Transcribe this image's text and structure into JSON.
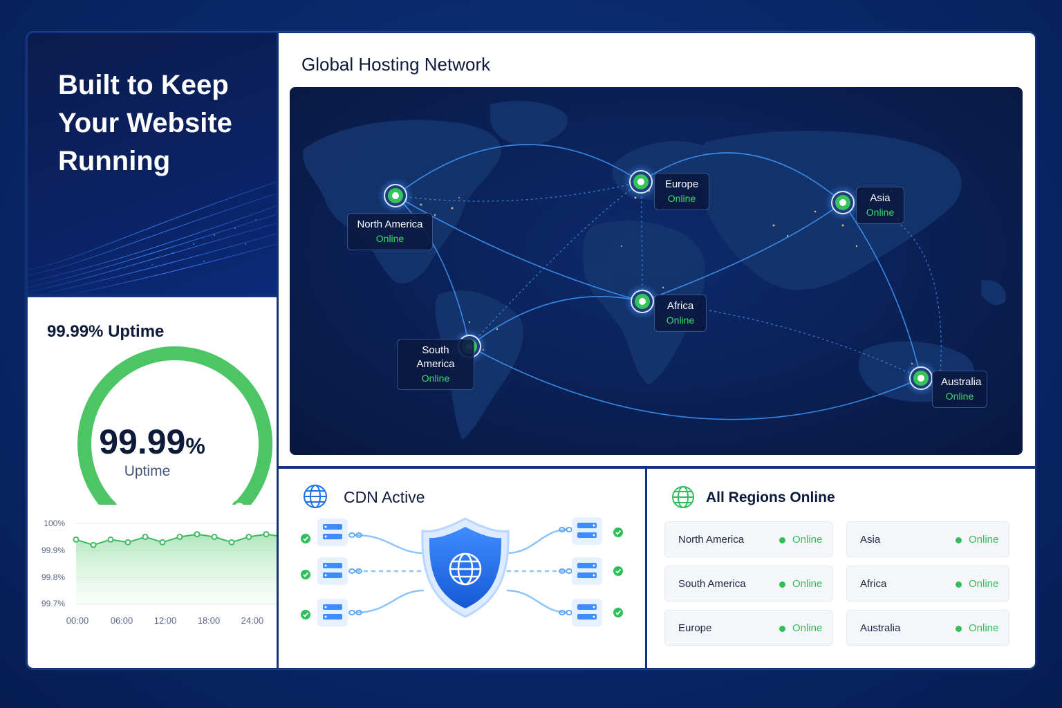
{
  "hero": {
    "headline_lines": [
      "Built to Keep",
      "Your Website",
      "Running"
    ]
  },
  "uptime": {
    "title": "99.99% Uptime",
    "gauge_number": "99.99",
    "gauge_unit": "%",
    "gauge_label": "Uptime",
    "gauge_fraction": 0.9999
  },
  "chart_data": {
    "type": "area",
    "title": "",
    "xlabel": "",
    "ylabel": "",
    "y_ticks": [
      "100%",
      "99.9%",
      "99.8%",
      "99.7%"
    ],
    "x_ticks": [
      "00:00",
      "06:00",
      "12:00",
      "18:00",
      "24:00"
    ],
    "ylim": [
      99.7,
      100.0
    ],
    "grid": true,
    "x": [
      0,
      2,
      4,
      6,
      8,
      10,
      12,
      14,
      16,
      18,
      20,
      22,
      24
    ],
    "values": [
      99.94,
      99.92,
      99.94,
      99.93,
      99.95,
      99.93,
      99.95,
      99.96,
      99.95,
      99.93,
      99.95,
      99.96,
      99.95
    ],
    "color": "#3dbb5e"
  },
  "map": {
    "title": "Global Hosting Network",
    "nodes": [
      {
        "name": "North America",
        "status": "Online"
      },
      {
        "name": "Europe",
        "status": "Online"
      },
      {
        "name": "Asia",
        "status": "Online"
      },
      {
        "name": "Africa",
        "status": "Online"
      },
      {
        "name": "South America",
        "status": "Online"
      },
      {
        "name": "Australia",
        "status": "Online"
      }
    ]
  },
  "cdn": {
    "title": "CDN Active",
    "icon": "globe-icon",
    "center_icon": "shield-globe-icon"
  },
  "regions": {
    "title": "All Regions Online",
    "icon": "globe-icon",
    "items": [
      {
        "name": "North America",
        "status": "Online"
      },
      {
        "name": "Asia",
        "status": "Online"
      },
      {
        "name": "South America",
        "status": "Online"
      },
      {
        "name": "Africa",
        "status": "Online"
      },
      {
        "name": "Europe",
        "status": "Online"
      },
      {
        "name": "Australia",
        "status": "Online"
      }
    ]
  },
  "colors": {
    "accent": "#1f6fe0",
    "online": "#2fbf5b",
    "background": "#0a2a6e"
  }
}
